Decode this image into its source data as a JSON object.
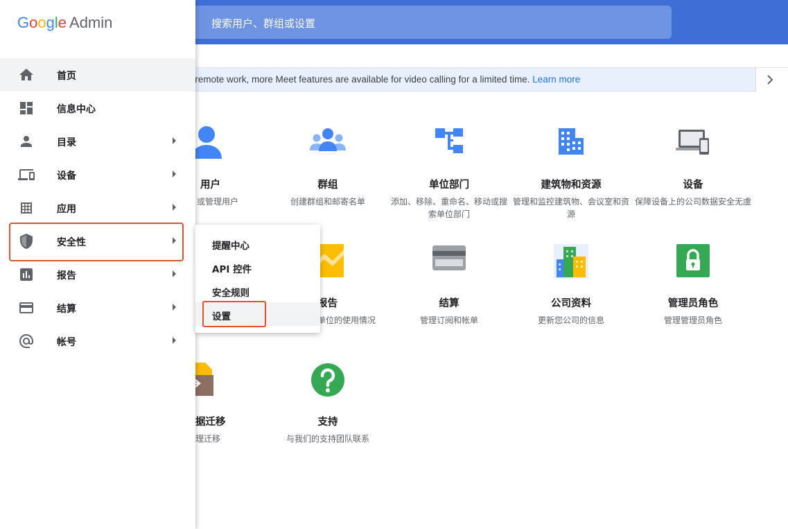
{
  "header": {
    "search_placeholder": "搜索用户、群组或设置"
  },
  "banner": {
    "text": "g remote work, more Meet features are available for video calling for a limited time.",
    "link": "Learn more"
  },
  "logo": {
    "google": "Google",
    "admin": "Admin"
  },
  "sidebar": {
    "items": [
      {
        "label": "首页",
        "icon": "home-icon"
      },
      {
        "label": "信息中心",
        "icon": "dashboard-icon"
      },
      {
        "label": "目录",
        "icon": "person-icon"
      },
      {
        "label": "设备",
        "icon": "devices-icon"
      },
      {
        "label": "应用",
        "icon": "apps-grid-icon"
      },
      {
        "label": "安全性",
        "icon": "shield-icon"
      },
      {
        "label": "报告",
        "icon": "bar-chart-icon"
      },
      {
        "label": "结算",
        "icon": "credit-card-icon"
      },
      {
        "label": "帐号",
        "icon": "at-sign-icon"
      }
    ]
  },
  "submenu": {
    "items": [
      {
        "label": "提醒中心"
      },
      {
        "label": "API 控件"
      },
      {
        "label": "安全规则"
      },
      {
        "label": "设置"
      }
    ]
  },
  "cards": {
    "users": {
      "title": "用户",
      "desc": "或管理用户"
    },
    "groups": {
      "title": "群组",
      "desc": "创建群组和邮寄名单"
    },
    "org_units": {
      "title": "单位部门",
      "desc": "添加、移除、重命名、移动或搜索单位部门"
    },
    "buildings": {
      "title": "建筑物和资源",
      "desc": "管理和监控建筑物、会议室和资源"
    },
    "devices": {
      "title": "设备",
      "desc": "保障设备上的公司数据安全无虞"
    },
    "reports": {
      "title": "报告",
      "desc": "单位的使用情况"
    },
    "billing": {
      "title": "结算",
      "desc": "管理订阅和帐单"
    },
    "company_profile": {
      "title": "公司资料",
      "desc": "更新您公司的信息"
    },
    "admin_roles": {
      "title": "管理员角色",
      "desc": "管理管理员角色"
    },
    "data_migration": {
      "title": "据迁移",
      "desc": "理迁移"
    },
    "support": {
      "title": "支持",
      "desc": "与我们的支持团队联系"
    }
  },
  "colors": {
    "header_blue": "#3f6fd6",
    "accent_blue": "#4285f4",
    "highlight_border": "#e0522e",
    "link": "#1a73e8"
  }
}
